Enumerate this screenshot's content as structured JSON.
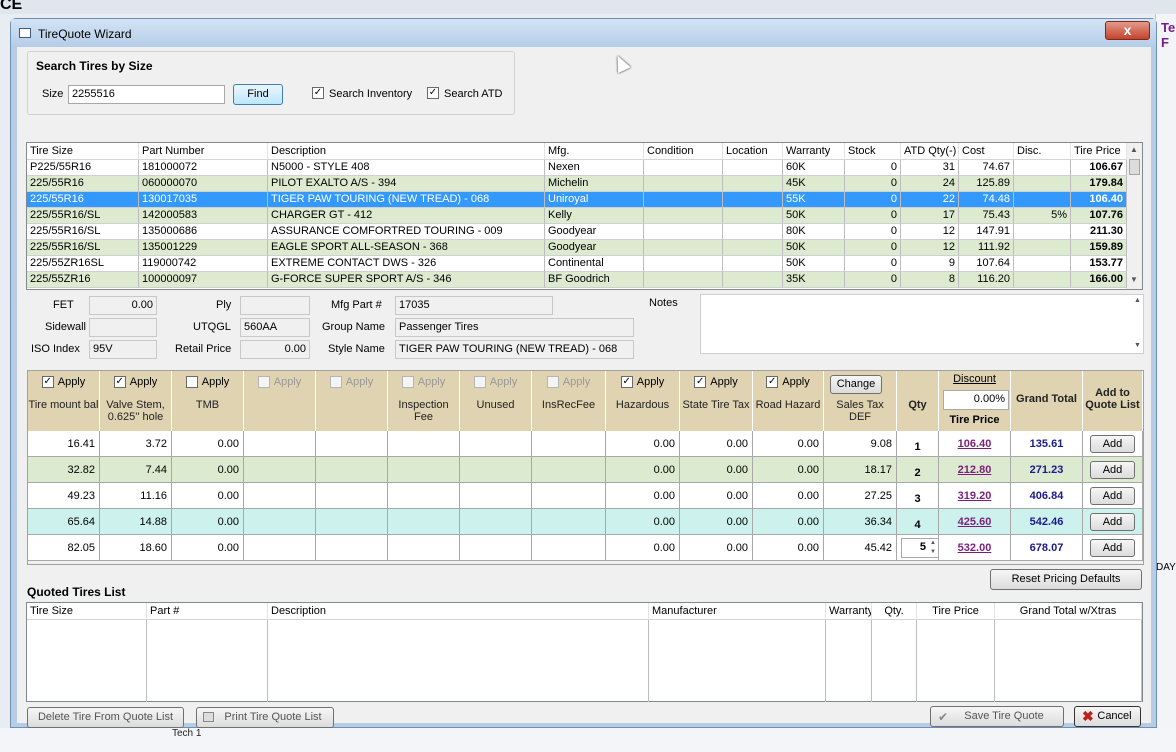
{
  "bg": {
    "app_code": "CE",
    "right_title": "Te F",
    "right_day": "DAY",
    "tech_label": "Tech 1"
  },
  "window": {
    "title": "TireQuote Wizard",
    "close_glyph": "x"
  },
  "search": {
    "group_title": "Search Tires by Size",
    "size_label": "Size",
    "size_value": "2255516",
    "find_label": "Find",
    "inventory_label": "Search Inventory",
    "atd_label": "Search ATD",
    "inventory_checked": true,
    "atd_checked": true
  },
  "results": {
    "columns": [
      "Tire Size",
      "Part Number",
      "Description",
      "Mfg.",
      "Condition",
      "Location",
      "Warranty",
      "Stock",
      "ATD Qty(-)",
      "Cost",
      "Disc.",
      "Tire Price"
    ],
    "rows": [
      [
        "P225/55R16",
        "181000072",
        "N5000 - STYLE 408",
        "Nexen",
        "",
        "",
        "60K",
        "0",
        "31",
        "74.67",
        "",
        "106.67"
      ],
      [
        "225/55R16",
        "060000070",
        "PILOT EXALTO A/S - 394",
        "Michelin",
        "",
        "",
        "45K",
        "0",
        "24",
        "125.89",
        "",
        "179.84"
      ],
      [
        "225/55R16",
        "130017035",
        "TIGER PAW TOURING (NEW TREAD) - 068",
        "Uniroyal",
        "",
        "",
        "55K",
        "0",
        "22",
        "74.48",
        "",
        "106.40"
      ],
      [
        "225/55R16/SL",
        "142000583",
        "CHARGER GT - 412",
        "Kelly",
        "",
        "",
        "50K",
        "0",
        "17",
        "75.43",
        "5%",
        "107.76"
      ],
      [
        "225/55R16/SL",
        "135000686",
        "ASSURANCE COMFORTRED TOURING - 009",
        "Goodyear",
        "",
        "",
        "80K",
        "0",
        "12",
        "147.91",
        "",
        "211.30"
      ],
      [
        "225/55R16/SL",
        "135001229",
        "EAGLE SPORT ALL-SEASON - 368",
        "Goodyear",
        "",
        "",
        "50K",
        "0",
        "12",
        "111.92",
        "",
        "159.89"
      ],
      [
        "225/55ZR16SL",
        "119000742",
        "EXTREME CONTACT DWS - 326",
        "Continental",
        "",
        "",
        "50K",
        "0",
        "9",
        "107.64",
        "",
        "153.77"
      ],
      [
        "225/55ZR16",
        "100000097",
        "G-FORCE SUPER SPORT A/S - 346",
        "BF Goodrich",
        "",
        "",
        "35K",
        "0",
        "8",
        "116.20",
        "",
        "166.00"
      ]
    ],
    "selected_index": 2
  },
  "details": {
    "fet_label": "FET",
    "fet_value": "0.00",
    "ply_label": "Ply",
    "ply_value": "",
    "mfgpart_label": "Mfg Part #",
    "mfgpart_value": "17035",
    "notes_label": "Notes",
    "sidewall_label": "Sidewall",
    "sidewall_value": "",
    "utqgl_label": "UTQGL",
    "utqgl_value": "560AA",
    "group_label": "Group Name",
    "group_value": "Passenger Tires",
    "iso_label": "ISO  Index",
    "iso_value": "95V",
    "retail_label": "Retail Price",
    "retail_value": "0.00",
    "style_label": "Style Name",
    "style_value": "TIGER PAW TOURING (NEW TREAD) - 068"
  },
  "pricing": {
    "apply_label": "Apply",
    "extras": [
      {
        "label": "Tire mount bal",
        "checked": true,
        "enabled": true
      },
      {
        "label": "Valve Stem, 0.625'' hole",
        "checked": true,
        "enabled": true
      },
      {
        "label": "TMB",
        "checked": false,
        "enabled": true
      },
      {
        "label": "",
        "checked": false,
        "enabled": false
      },
      {
        "label": "",
        "checked": false,
        "enabled": false
      },
      {
        "label": "Inspection Fee",
        "checked": false,
        "enabled": false
      },
      {
        "label": "Unused",
        "checked": false,
        "enabled": false
      },
      {
        "label": "InsRecFee",
        "checked": false,
        "enabled": false
      },
      {
        "label": "Hazardous",
        "checked": true,
        "enabled": true
      },
      {
        "label": "State Tire Tax",
        "checked": true,
        "enabled": true
      },
      {
        "label": "Road Hazard",
        "checked": true,
        "enabled": true
      }
    ],
    "change_label": "Change",
    "sales_tax_label": "Sales Tax DEF",
    "qty_label": "Qty",
    "discount_label": "Discount",
    "discount_value": "0.00%",
    "tire_price_label": "Tire Price",
    "grand_total_label": "Grand Total",
    "add_to_list_label": "Add to Quote List",
    "add_label": "Add",
    "rows": [
      {
        "vals": [
          "16.41",
          "3.72",
          "0.00",
          "",
          "",
          "",
          "",
          "",
          "0.00",
          "0.00",
          "0.00",
          "9.08"
        ],
        "qty": "1",
        "price": "106.40",
        "total": "135.61"
      },
      {
        "vals": [
          "32.82",
          "7.44",
          "0.00",
          "",
          "",
          "",
          "",
          "",
          "0.00",
          "0.00",
          "0.00",
          "18.17"
        ],
        "qty": "2",
        "price": "212.80",
        "total": "271.23"
      },
      {
        "vals": [
          "49.23",
          "11.16",
          "0.00",
          "",
          "",
          "",
          "",
          "",
          "0.00",
          "0.00",
          "0.00",
          "27.25"
        ],
        "qty": "3",
        "price": "319.20",
        "total": "406.84"
      },
      {
        "vals": [
          "65.64",
          "14.88",
          "0.00",
          "",
          "",
          "",
          "",
          "",
          "0.00",
          "0.00",
          "0.00",
          "36.34"
        ],
        "qty": "4",
        "price": "425.60",
        "total": "542.46"
      },
      {
        "vals": [
          "82.05",
          "18.60",
          "0.00",
          "",
          "",
          "",
          "",
          "",
          "0.00",
          "0.00",
          "0.00",
          "45.42"
        ],
        "qty": "5",
        "price": "532.00",
        "total": "678.07"
      }
    ],
    "row_colors": [
      "#ffffff",
      "#dcebd0",
      "#ffffff",
      "#cdf2ee",
      "#ffffff"
    ]
  },
  "reset_label": "Reset Pricing Defaults",
  "quoted": {
    "title": "Quoted Tires List",
    "columns": [
      "Tire Size",
      "Part #",
      "Description",
      "Manufacturer",
      "Warranty",
      "Qty.",
      "Tire Price",
      "Grand Total w/Xtras"
    ]
  },
  "footer": {
    "delete_label": "Delete Tire  From Quote List",
    "print_label": "Print Tire Quote List",
    "save_label": "Save Tire Quote",
    "cancel_label": "Cancel"
  },
  "colors": {
    "selected_row": "#3399ff",
    "green_row": "#dcebd0",
    "header_tan": "#dfd3b2",
    "link_purple": "#7b1f7b",
    "total_blue": "#1a1a8c"
  }
}
